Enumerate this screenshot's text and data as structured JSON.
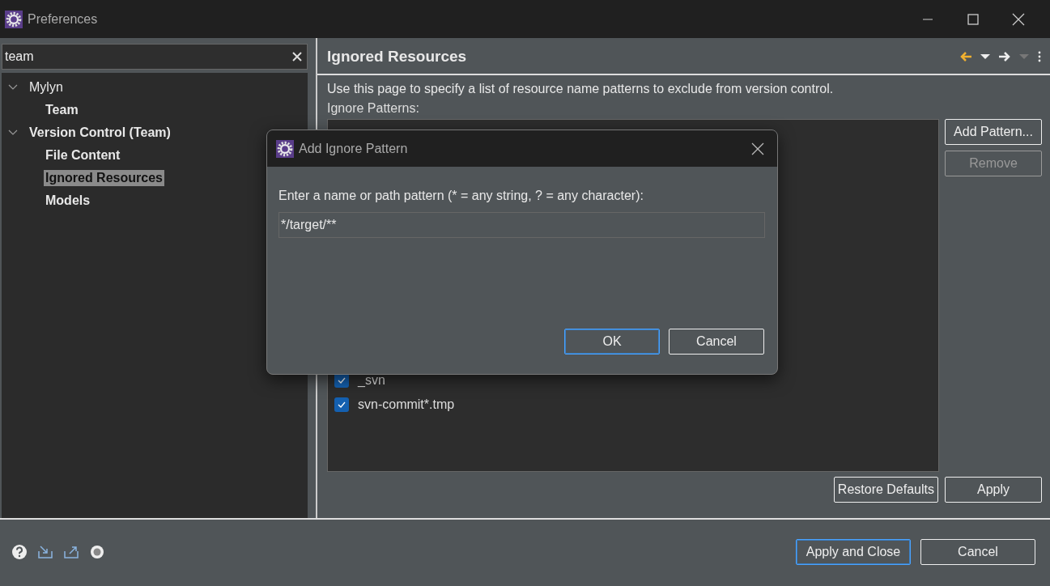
{
  "window": {
    "title": "Preferences"
  },
  "filter": {
    "value": "team"
  },
  "tree": [
    {
      "label": "Mylyn",
      "bold": false,
      "expanded": true,
      "selected": false,
      "children": [
        {
          "label": "Team",
          "bold": true,
          "selected": false
        }
      ]
    },
    {
      "label": "Version Control (Team)",
      "bold": true,
      "expanded": true,
      "selected": false,
      "children": [
        {
          "label": "File Content",
          "bold": true,
          "selected": false
        },
        {
          "label": "Ignored Resources",
          "bold": true,
          "selected": true
        },
        {
          "label": "Models",
          "bold": true,
          "selected": false
        }
      ]
    }
  ],
  "page": {
    "title": "Ignored Resources",
    "description": "Use this page to specify a list of resource name patterns to exclude from version control.",
    "patterns_label": "Ignore Patterns:",
    "patterns": [
      {
        "label": "_svn",
        "checked": true
      },
      {
        "label": "svn-commit*.tmp",
        "checked": true
      }
    ],
    "side_buttons": [
      {
        "label": "Add Pattern...",
        "disabled": false
      },
      {
        "label": "Remove",
        "disabled": true
      }
    ],
    "buttons": [
      "Restore Defaults",
      "Apply"
    ]
  },
  "footer_buttons": [
    {
      "label": "Apply and Close",
      "default": true
    },
    {
      "label": "Cancel",
      "default": false
    }
  ],
  "dialog": {
    "title": "Add Ignore Pattern",
    "prompt": "Enter a name or path pattern (* = any string, ? = any character):",
    "value": "*/target/**",
    "buttons": [
      {
        "label": "OK",
        "default": true
      },
      {
        "label": "Cancel",
        "default": false
      }
    ]
  }
}
